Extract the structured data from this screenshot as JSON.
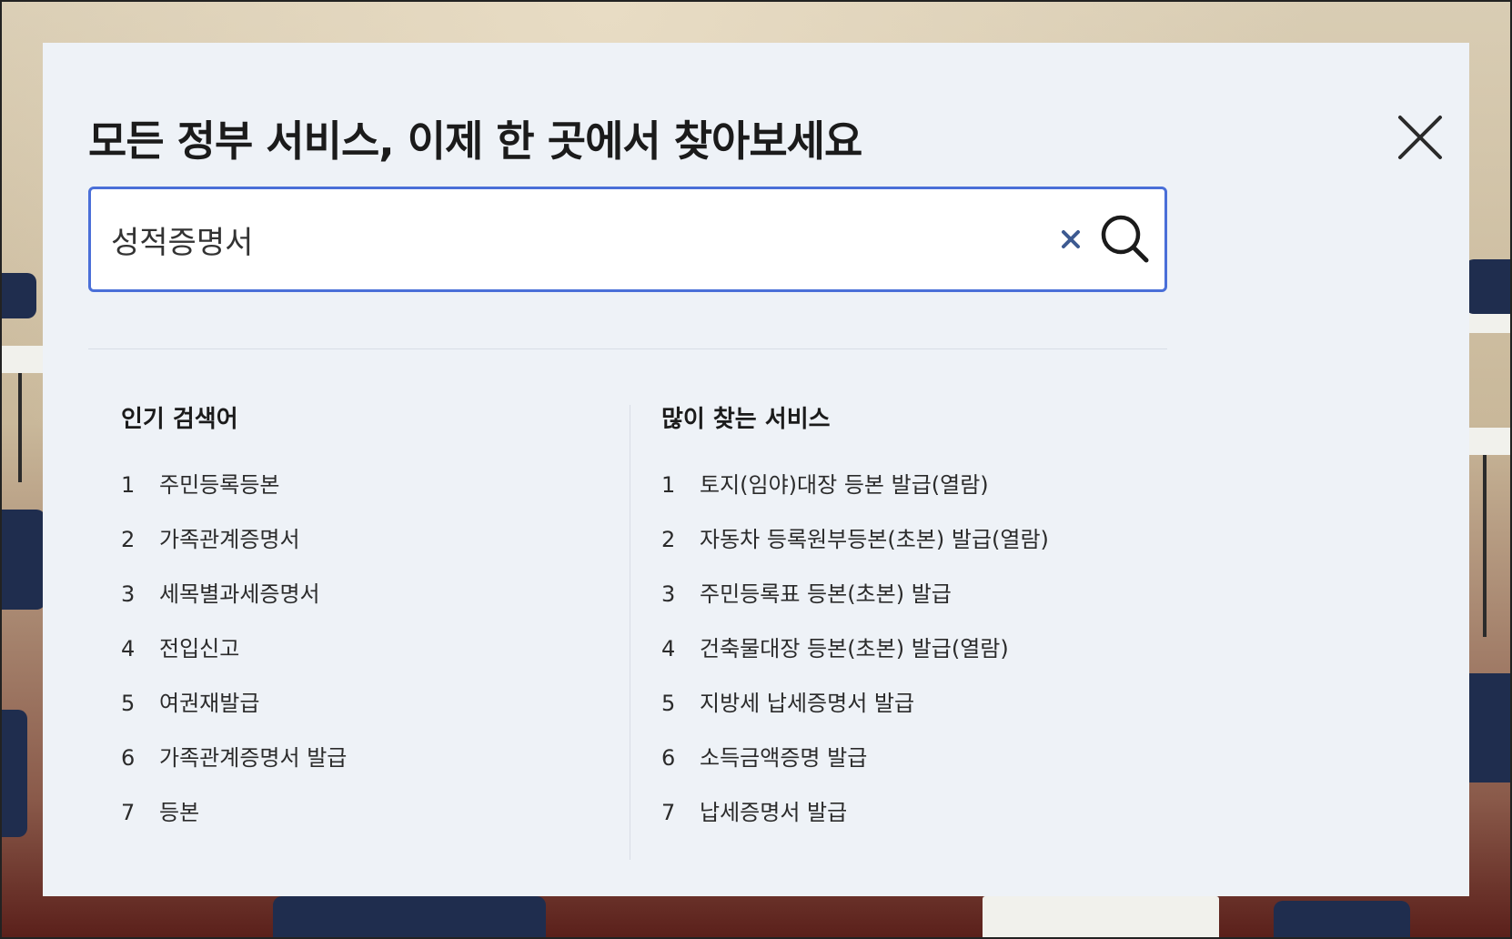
{
  "modal": {
    "title": "모든 정부 서비스, 이제 한 곳에서 찾아보세요",
    "close_icon": "close-icon"
  },
  "search": {
    "value": "성적증명서",
    "clear_icon": "clear-icon",
    "search_icon": "search-icon"
  },
  "popular": {
    "heading": "인기 검색어",
    "items": [
      {
        "rank": "1",
        "label": "주민등록등본"
      },
      {
        "rank": "2",
        "label": "가족관계증명서"
      },
      {
        "rank": "3",
        "label": "세목별과세증명서"
      },
      {
        "rank": "4",
        "label": "전입신고"
      },
      {
        "rank": "5",
        "label": "여권재발급"
      },
      {
        "rank": "6",
        "label": "가족관계증명서 발급"
      },
      {
        "rank": "7",
        "label": "등본"
      }
    ]
  },
  "services": {
    "heading": "많이 찾는 서비스",
    "items": [
      {
        "rank": "1",
        "label": "토지(임야)대장 등본 발급(열람)"
      },
      {
        "rank": "2",
        "label": "자동차 등록원부등본(초본) 발급(열람)"
      },
      {
        "rank": "3",
        "label": "주민등록표 등본(초본) 발급"
      },
      {
        "rank": "4",
        "label": "건축물대장 등본(초본) 발급(열람)"
      },
      {
        "rank": "5",
        "label": "지방세 납세증명서 발급"
      },
      {
        "rank": "6",
        "label": "소득금액증명 발급"
      },
      {
        "rank": "7",
        "label": "납세증명서 발급"
      }
    ]
  },
  "colors": {
    "modal_bg": "#eef2f7",
    "search_border": "#4a6fd8",
    "clear_icon": "#3d5a91",
    "text": "#1b1b1b"
  }
}
